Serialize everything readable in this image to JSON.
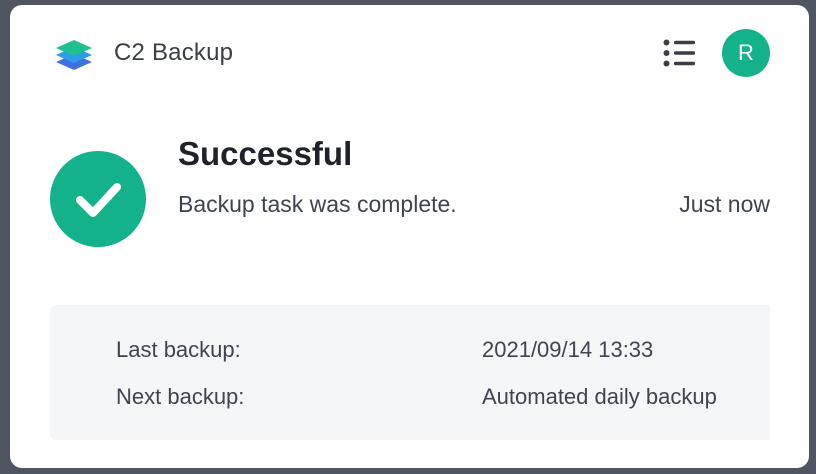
{
  "app": {
    "title": "C2 Backup",
    "logo_icon": "stacked-layers-icon",
    "menu_icon": "list-menu-icon",
    "avatar_initial": "R"
  },
  "status": {
    "icon": "check-circle-icon",
    "title": "Successful",
    "message": "Backup task was complete.",
    "time": "Just now"
  },
  "details": [
    {
      "label": "Last backup:",
      "value": "2021/09/14 13:33"
    },
    {
      "label": "Next backup:",
      "value": "Automated daily backup"
    }
  ],
  "colors": {
    "accent": "#13b28a",
    "background": "#4f5661",
    "card": "#ffffff",
    "panel": "#f5f6f8"
  }
}
